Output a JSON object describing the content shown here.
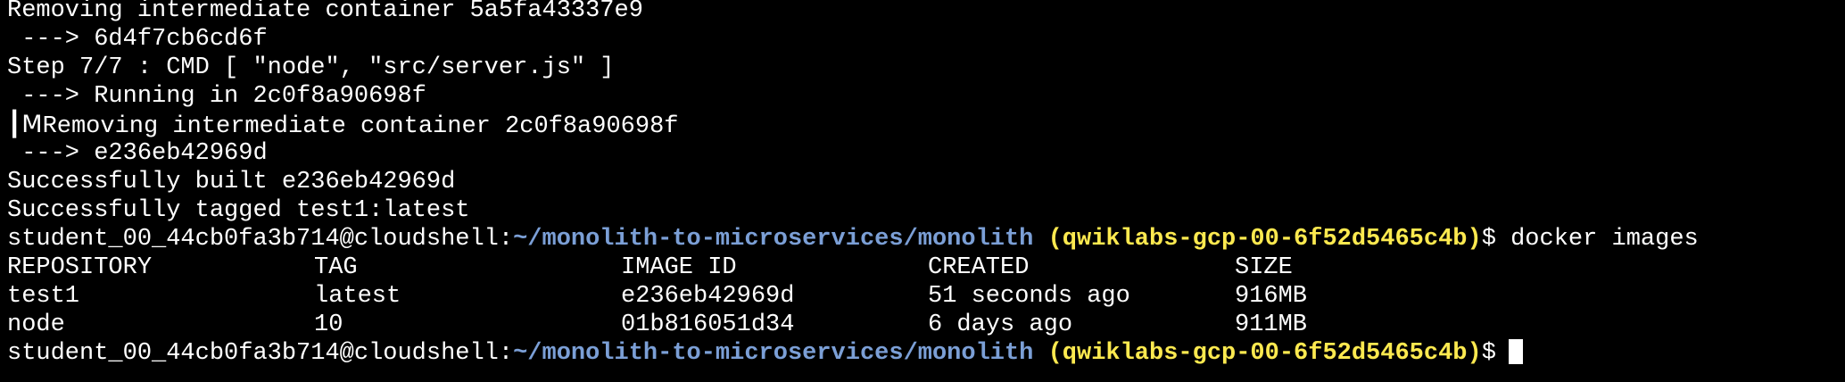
{
  "terminal": {
    "build_output": [
      "Removing intermediate container 5a5fa43337e9",
      " ---> 6d4f7cb6cd6f",
      "Step 7/7 : CMD [ \"node\", \"src/server.js\" ]",
      " ---> Running in 2c0f8a90698f"
    ],
    "garbled_prefix": "┃M",
    "garbled_line_text": "Removing intermediate container 2c0f8a90698f",
    "build_output_2": [
      " ---> e236eb42969d",
      "Successfully built e236eb42969d",
      "Successfully tagged test1:latest"
    ],
    "prompt": {
      "user": "student_00_44cb0fa3b714@cloudshell:",
      "path": "~/monolith-to-microservices/monolith",
      "project": "(qwiklabs-gcp-00-6f52d5465c4b)",
      "symbol": "$"
    },
    "command": "docker images",
    "table": {
      "headers": [
        "REPOSITORY",
        "TAG",
        "IMAGE ID",
        "CREATED",
        "SIZE"
      ],
      "rows": [
        [
          "test1",
          "latest",
          "e236eb42969d",
          "51 seconds ago",
          "916MB"
        ],
        [
          "node",
          "10",
          "01b816051d34",
          "6 days ago",
          "911MB"
        ]
      ]
    }
  },
  "colors": {
    "background": "#000000",
    "text": "#ffffff",
    "path": "#7b9fd6",
    "project": "#fce94f"
  }
}
